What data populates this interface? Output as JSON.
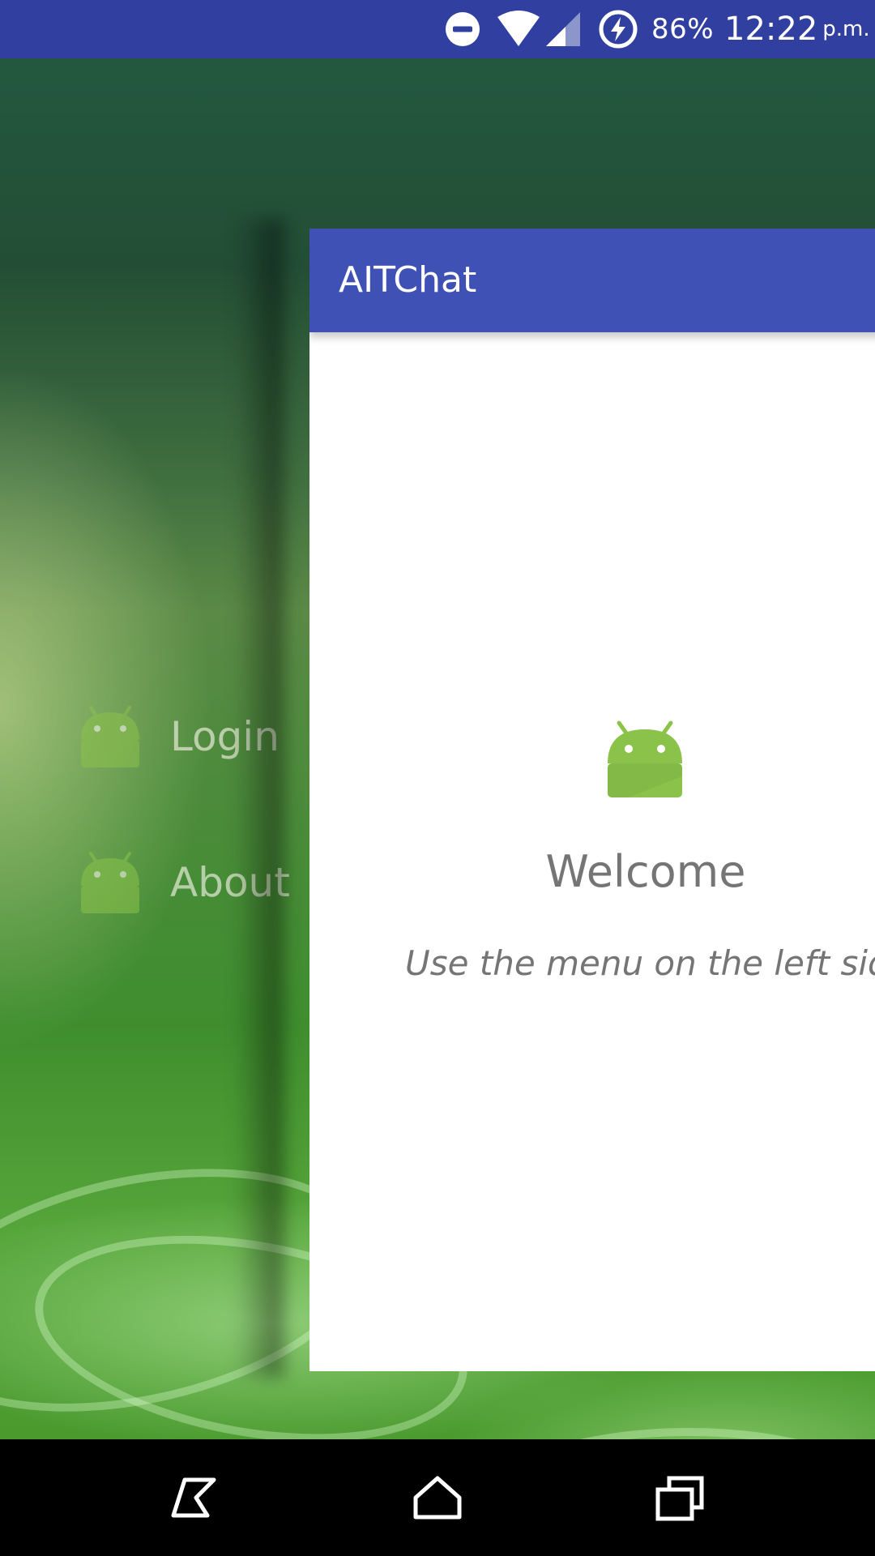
{
  "status_bar": {
    "battery_percent": "86%",
    "time": "12:22",
    "ampm": "p.m.",
    "icons": [
      "do-not-disturb-icon",
      "wifi-icon",
      "signal-icon",
      "battery-charging-icon"
    ]
  },
  "drawer": {
    "items": [
      {
        "label": "Login",
        "icon": "android-icon"
      },
      {
        "label": "About",
        "icon": "android-icon"
      }
    ]
  },
  "app_bar": {
    "title": "AITChat",
    "color": "#3f51b5"
  },
  "main": {
    "welcome_title": "Welcome",
    "welcome_subtitle": "Use the menu on the left side.",
    "logo_icon": "android-icon",
    "text_color": "#757575"
  },
  "nav_bar": {
    "buttons": [
      "back-icon",
      "home-icon",
      "recents-icon"
    ]
  },
  "colors": {
    "status_bar": "#3140a0",
    "android_green": "#8bc34a"
  }
}
